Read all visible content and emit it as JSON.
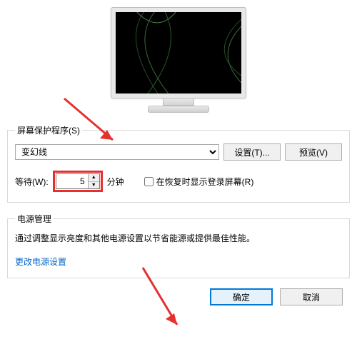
{
  "screensaver_group": {
    "legend": "屏幕保护程序(S)",
    "dropdown_selected": "变幻线",
    "settings_button": "设置(T)...",
    "preview_button": "预览(V)",
    "wait_label": "等待(W):",
    "wait_value": "5",
    "minutes_label": "分钟",
    "resume_checkbox_label": "在恢复时显示登录屏幕(R)",
    "resume_checked": false
  },
  "power_group": {
    "legend": "电源管理",
    "description": "通过调整显示亮度和其他电源设置以节省能源或提供最佳性能。",
    "link": "更改电源设置"
  },
  "dialog": {
    "ok": "确定",
    "cancel": "取消"
  }
}
